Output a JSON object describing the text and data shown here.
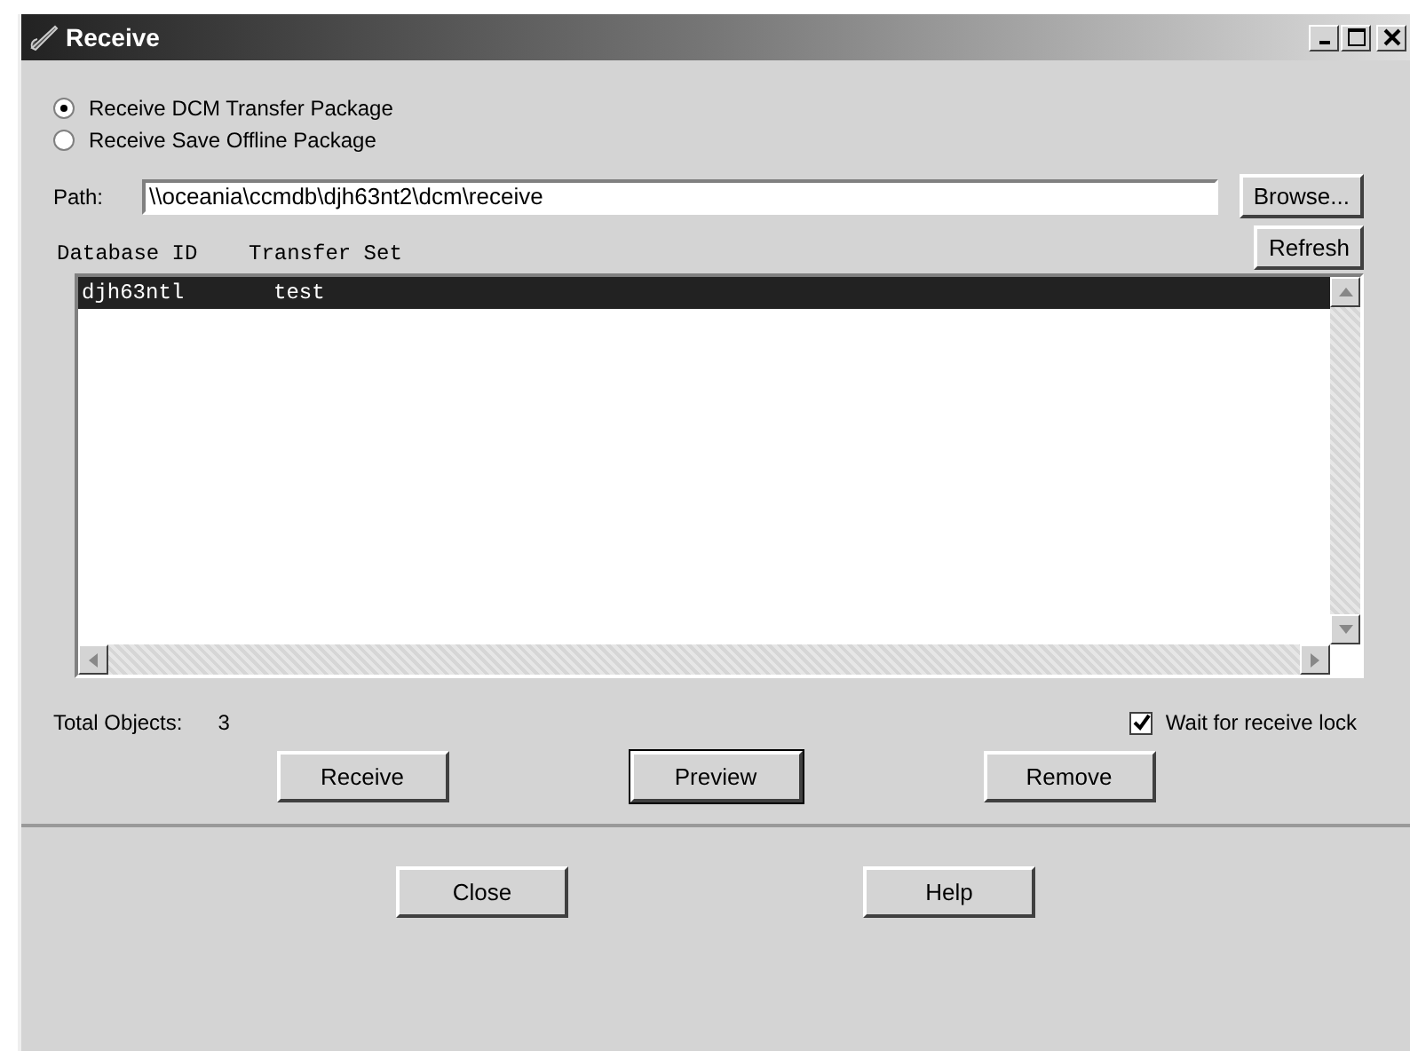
{
  "window": {
    "title": "Receive"
  },
  "package_types": [
    {
      "label": "Receive DCM Transfer Package",
      "selected": true
    },
    {
      "label": "Receive Save Offline Package",
      "selected": false
    }
  ],
  "path": {
    "label": "Path:",
    "value": "\\\\oceania\\ccmdb\\djh63nt2\\dcm\\receive"
  },
  "browse_button": "Browse...",
  "refresh_button": "Refresh",
  "list": {
    "columns": [
      "Database ID",
      "Transfer Set"
    ],
    "rows": [
      {
        "cells": [
          "djh63ntl",
          "test"
        ],
        "selected": true
      }
    ]
  },
  "total": {
    "label": "Total Objects:",
    "value": "3"
  },
  "wait_lock": {
    "label": "Wait for receive lock",
    "checked": true
  },
  "actions": [
    {
      "label": "Receive",
      "default": false
    },
    {
      "label": "Preview",
      "default": true
    },
    {
      "label": "Remove",
      "default": false
    }
  ],
  "footer_buttons": [
    {
      "label": "Close",
      "default": false
    },
    {
      "label": "Help",
      "default": false
    }
  ]
}
